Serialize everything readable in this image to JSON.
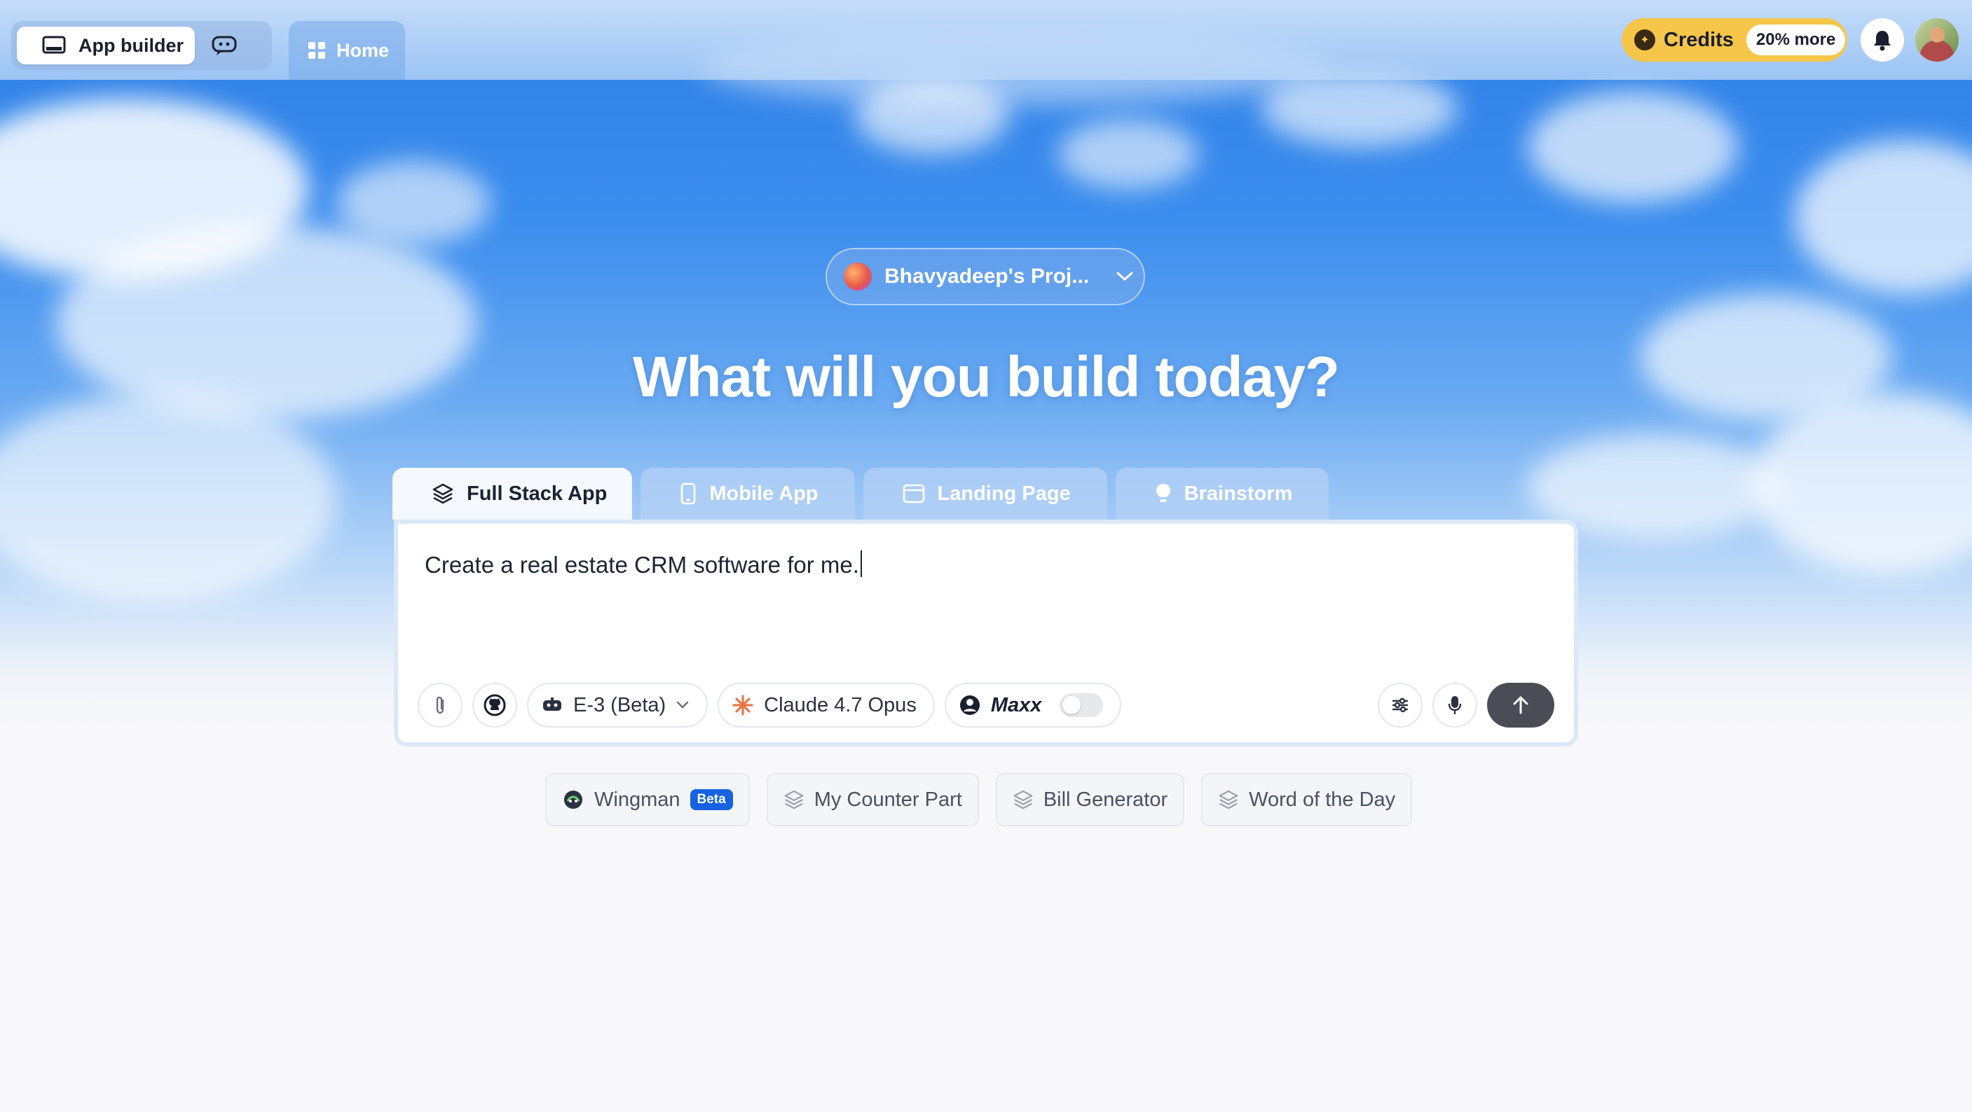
{
  "topbar": {
    "app_builder_label": "App builder",
    "home_label": "Home",
    "credits_label": "Credits",
    "credits_badge": "20% more"
  },
  "project": {
    "name": "Bhavyadeep's Proj..."
  },
  "headline": "What will you build today?",
  "tabs": [
    {
      "label": "Full Stack App",
      "icon": "layers-icon"
    },
    {
      "label": "Mobile App",
      "icon": "phone-icon"
    },
    {
      "label": "Landing Page",
      "icon": "browser-icon"
    },
    {
      "label": "Brainstorm",
      "icon": "lightbulb-icon"
    }
  ],
  "prompt": {
    "text": "Create a real estate CRM software for me.",
    "agent_label": "E-3 (Beta)",
    "model_label": "Claude 4.7 Opus",
    "maxx_label": "Maxx"
  },
  "suggestions": [
    {
      "label": "Wingman",
      "badge": "Beta"
    },
    {
      "label": "My Counter Part"
    },
    {
      "label": "Bill Generator"
    },
    {
      "label": "Word of the Day"
    }
  ],
  "colors": {
    "sky": "#2e7fe6",
    "credits": "#f6c64a",
    "beta_badge": "#1662e0",
    "send_button": "#4a4d55",
    "model_spark": "#e8774a"
  }
}
